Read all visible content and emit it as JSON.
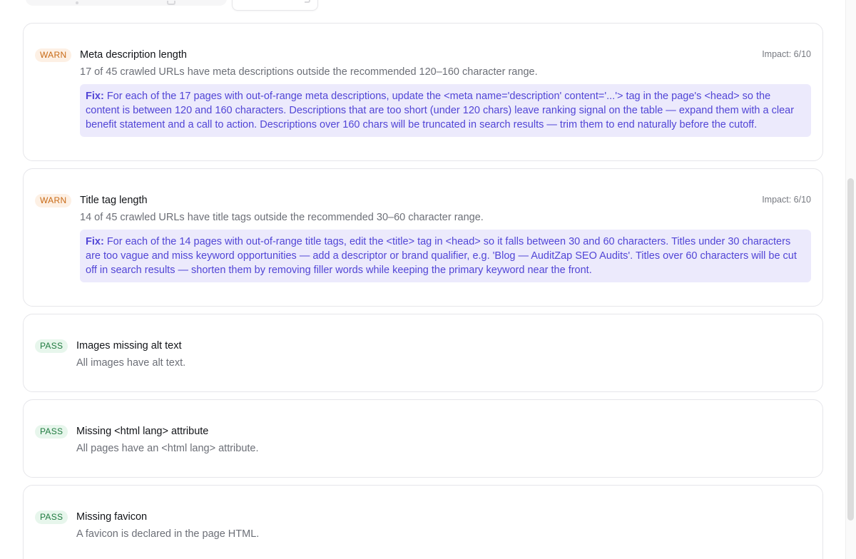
{
  "checks": [
    {
      "status": "WARN",
      "title": "Meta description length",
      "description": "17 of 45 crawled URLs have meta descriptions outside the recommended 120–160 character range.",
      "impact": "Impact: 6/10",
      "fix_label": "Fix:",
      "fix_text": "For each of the 17 pages with out-of-range meta descriptions, update the <meta name='description' content='...'> tag in the page's <head> so the content is between 120 and 160 characters. Descriptions that are too short (under 120 chars) leave ranking signal on the table — expand them with a clear benefit statement and a call to action. Descriptions over 160 chars will be truncated in search results — trim them to end naturally before the cutoff."
    },
    {
      "status": "WARN",
      "title": "Title tag length",
      "description": "14 of 45 crawled URLs have title tags outside the recommended 30–60 character range.",
      "impact": "Impact: 6/10",
      "fix_label": "Fix:",
      "fix_text": "For each of the 14 pages with out-of-range title tags, edit the <title> tag in <head> so it falls between 30 and 60 characters. Titles under 30 characters are too vague and miss keyword opportunities — add a descriptor or brand qualifier, e.g. 'Blog — AuditZap SEO Audits'. Titles over 60 characters will be cut off in search results — shorten them by removing filler words while keeping the primary keyword near the front."
    },
    {
      "status": "PASS",
      "title": "Images missing alt text",
      "description": "All images have alt text."
    },
    {
      "status": "PASS",
      "title": "Missing <html lang> attribute",
      "description": "All pages have an <html lang> attribute."
    },
    {
      "status": "PASS",
      "title": "Missing favicon",
      "description": "A favicon is declared in the page HTML."
    }
  ],
  "colors": {
    "warn_bg": "#fdf0e4",
    "warn_text": "#c86a16",
    "pass_bg": "#e7f6ec",
    "pass_text": "#1e7a3e",
    "fix_bg": "#eceafc",
    "fix_text": "#5145d6"
  }
}
